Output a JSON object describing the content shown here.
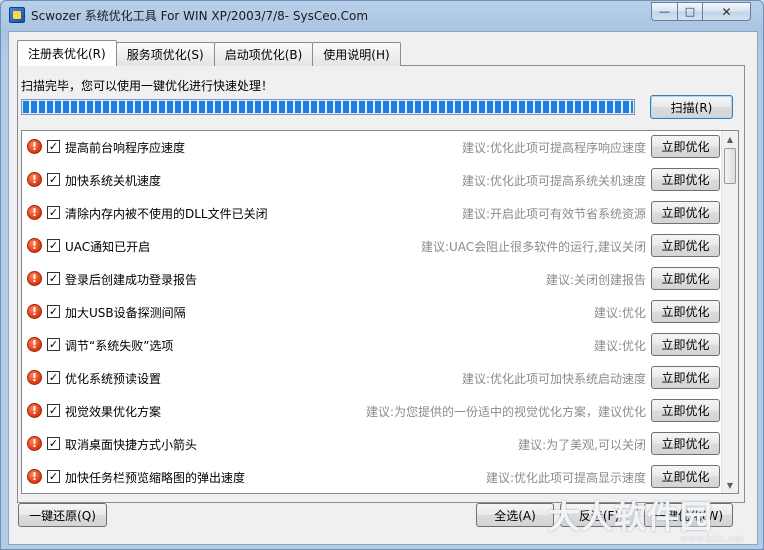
{
  "window": {
    "title": "Scwozer 系统优化工具 For WIN XP/2003/7/8- SysCeo.Com",
    "min_symbol": "—",
    "max_symbol": "□",
    "close_symbol": "✕"
  },
  "tabs": [
    {
      "label": "注册表优化(R)",
      "active": true
    },
    {
      "label": "服务项优化(S)",
      "active": false
    },
    {
      "label": "启动项优化(B)",
      "active": false
    },
    {
      "label": "使用说明(H)",
      "active": false
    }
  ],
  "status": {
    "text": "扫描完毕，您可以使用一键优化进行快速处理！",
    "progress": 1.0
  },
  "scan_button": "扫描(R)",
  "row_button_label": "立即优化",
  "items": [
    {
      "label": "提高前台响程序应速度",
      "hint": "建议:优化此项可提高程序响应速度",
      "checked": true
    },
    {
      "label": "加快系统关机速度",
      "hint": "建议:优化此项可提高系统关机速度",
      "checked": true
    },
    {
      "label": "清除内存内被不使用的DLL文件已关闭",
      "hint": "建议:开启此项可有效节省系统资源",
      "checked": true
    },
    {
      "label": "UAC通知已开启",
      "hint": "建议:UAC会阻止很多软件的运行,建议关闭",
      "checked": true
    },
    {
      "label": "登录后创建成功登录报告",
      "hint": "建议:关闭创建报告",
      "checked": true
    },
    {
      "label": "加大USB设备探测间隔",
      "hint": "建议:优化",
      "checked": true
    },
    {
      "label": "调节“系统失败”选项",
      "hint": "建议:优化",
      "checked": true
    },
    {
      "label": "优化系统预读设置",
      "hint": "建议:优化此项可加快系统启动速度",
      "checked": true
    },
    {
      "label": "视觉效果优化方案",
      "hint": "建议:为您提供的一份适中的视觉优化方案，建议优化",
      "checked": true
    },
    {
      "label": "取消桌面快捷方式小箭头",
      "hint": "建议:为了美观,可以关闭",
      "checked": true
    },
    {
      "label": "加快任务栏预览缩略图的弹出速度",
      "hint": "建议:优化此项可提高显示速度",
      "checked": true
    }
  ],
  "footer": {
    "restore": "一键还原(Q)",
    "select_all": "全选(A)",
    "invert": "反选(F)",
    "one_click": "一键优化(W)"
  },
  "watermark": {
    "main": "大人软件园",
    "sub": "www.kkx.net"
  }
}
